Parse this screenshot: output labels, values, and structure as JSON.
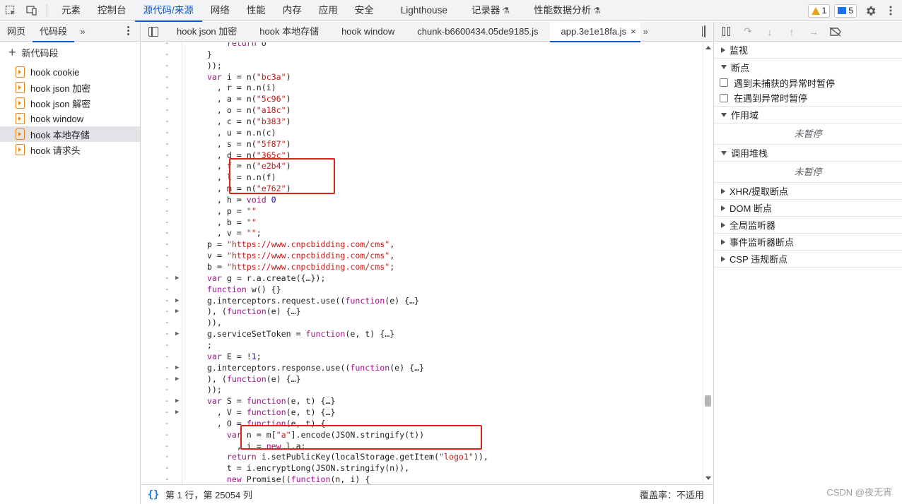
{
  "topbar": {
    "tabs": [
      {
        "label": "元素"
      },
      {
        "label": "控制台"
      },
      {
        "label": "源代码/来源",
        "active": true
      },
      {
        "label": "网络"
      },
      {
        "label": "性能"
      },
      {
        "label": "内存"
      },
      {
        "label": "应用"
      },
      {
        "label": "安全"
      },
      {
        "label": "Lighthouse"
      },
      {
        "label": "记录器",
        "beaker": true
      },
      {
        "label": "性能数据分析",
        "beaker": true
      }
    ],
    "warnings_count": "1",
    "messages_count": "5"
  },
  "navigator": {
    "tabs": [
      "网页",
      "代码段"
    ],
    "active_tab": "代码段",
    "new_snippet_label": "新代码段",
    "snippets": [
      {
        "label": "hook cookie"
      },
      {
        "label": "hook json 加密"
      },
      {
        "label": "hook json 解密"
      },
      {
        "label": "hook window"
      },
      {
        "label": "hook 本地存储",
        "selected": true
      },
      {
        "label": "hook 请求头"
      }
    ]
  },
  "editor": {
    "tabs": [
      {
        "label": "hook json 加密"
      },
      {
        "label": "hook 本地存储"
      },
      {
        "label": "hook window"
      },
      {
        "label": "chunk-b6600434.05de9185.js"
      },
      {
        "label": "app.3e1e18fa.js",
        "active": true
      }
    ],
    "lines": [
      {
        "t": "        return o"
      },
      {
        "t": "    }"
      },
      {
        "t": "    ));"
      },
      {
        "t": "    var i = n(\"bc3a\")"
      },
      {
        "t": "      , r = n.n(i)"
      },
      {
        "t": "      , a = n(\"5c96\")"
      },
      {
        "t": "      , o = n(\"a18c\")"
      },
      {
        "t": "      , c = n(\"b383\")"
      },
      {
        "t": "      , u = n.n(c)"
      },
      {
        "t": "      , s = n(\"5f87\")"
      },
      {
        "t": "      , d = n(\"365c\")"
      },
      {
        "t": "      , f = n(\"e2b4\")"
      },
      {
        "t": "      , l = n.n(f)"
      },
      {
        "t": "      , m = n(\"e762\")"
      },
      {
        "t": "      , h = void 0"
      },
      {
        "t": "      , p = \"\""
      },
      {
        "t": "      , b = \"\""
      },
      {
        "t": "      , v = \"\";"
      },
      {
        "t": "    p = \"https://www.cnpcbidding.com/cms\","
      },
      {
        "t": "    v = \"https://www.cnpcbidding.com/cms\","
      },
      {
        "t": "    b = \"https://www.cnpcbidding.com/cms\";"
      },
      {
        "t": "    var g = r.a.create({…});",
        "arrow": true
      },
      {
        "t": "    function w() {}"
      },
      {
        "t": "    g.interceptors.request.use((function(e) {…}",
        "arrow": true
      },
      {
        "t": "    ), (function(e) {…}",
        "arrow": true
      },
      {
        "t": "    )),"
      },
      {
        "t": "    g.serviceSetToken = function(e, t) {…}",
        "arrow": true
      },
      {
        "t": "    ;"
      },
      {
        "t": "    var E = !1;"
      },
      {
        "t": "    g.interceptors.response.use((function(e) {…}",
        "arrow": true
      },
      {
        "t": "    ), (function(e) {…}",
        "arrow": true
      },
      {
        "t": "    ));"
      },
      {
        "t": "    var S = function(e, t) {…}",
        "arrow": true
      },
      {
        "t": "      , V = function(e, t) {…}",
        "arrow": true
      },
      {
        "t": "      , O = function(e, t) {"
      },
      {
        "t": "        var n = m[\"a\"].encode(JSON.stringify(t))"
      },
      {
        "t": "          , i = new l.a;"
      },
      {
        "t": "        return i.setPublicKey(localStorage.getItem(\"logo1\")),"
      },
      {
        "t": "        t = i.encryptLong(JSON.stringify(n)),"
      },
      {
        "t": "        new Promise((function(n, i) {"
      }
    ]
  },
  "status": {
    "position": "第 1 行，第 25054 列",
    "coverage": "覆盖率：不适用"
  },
  "debugger": {
    "sections": {
      "watch": "监视",
      "breakpoints": "断点",
      "pause_uncaught": "遇到未捕获的异常时暂停",
      "pause_caught": "在遇到异常时暂停",
      "scope": "作用域",
      "not_paused": "未暂停",
      "call_stack": "调用堆栈",
      "not_paused_2": "未暂停",
      "xhr": "XHR/提取断点",
      "dom": "DOM 断点",
      "global": "全局监听器",
      "event": "事件监听器断点",
      "csp": "CSP 违规断点"
    }
  },
  "watermark": "CSDN @夜无宵",
  "colors": {
    "accent": "#0b57d0",
    "highlight_box": "#e0201b",
    "keyword": "#aa0d91",
    "string": "#c41a16"
  }
}
